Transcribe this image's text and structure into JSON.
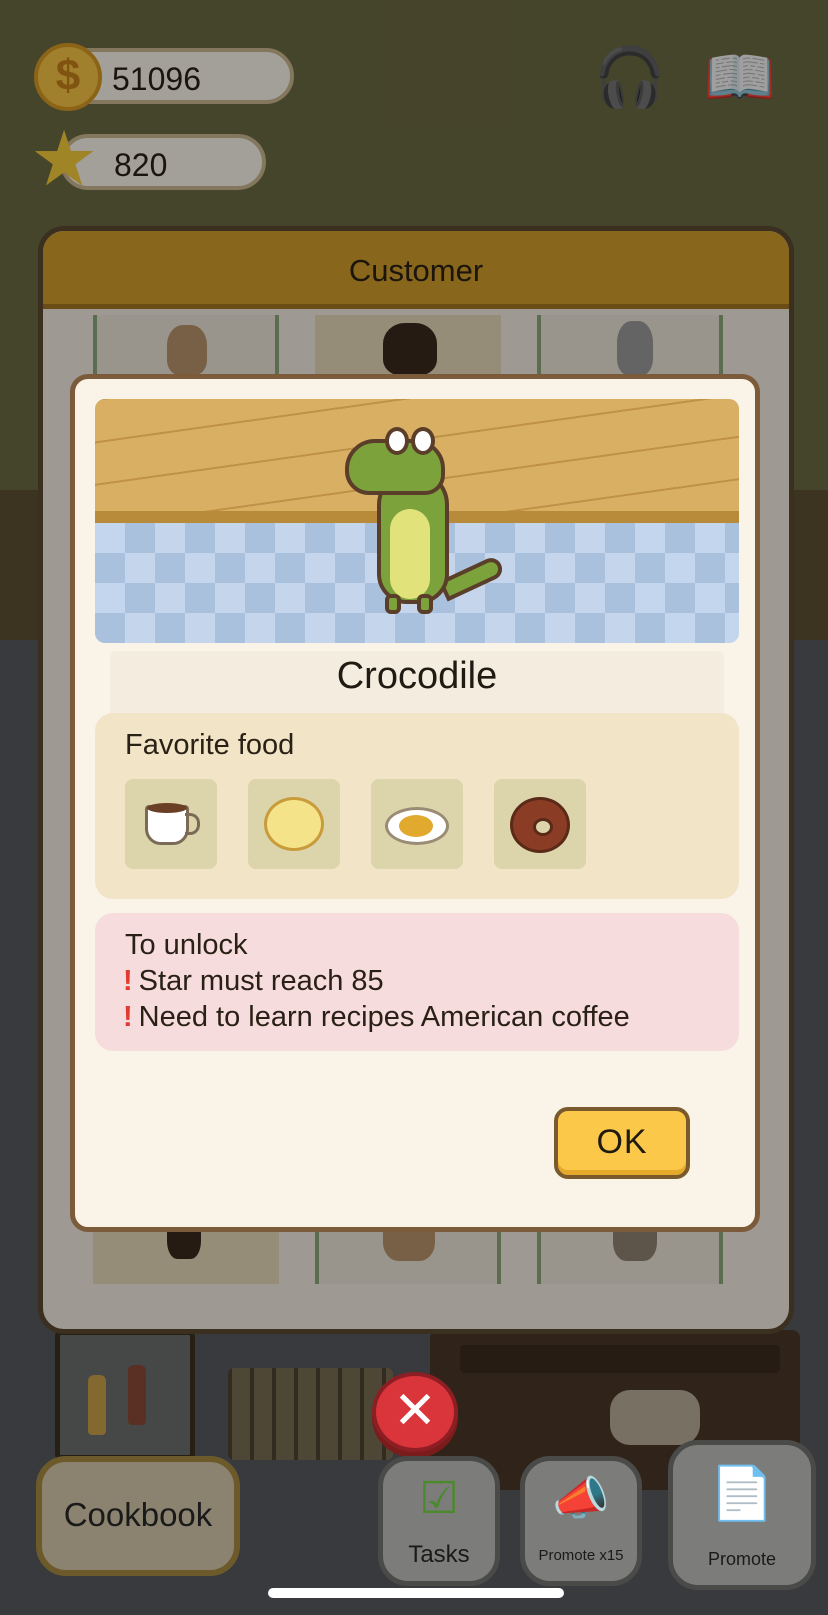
{
  "currency": {
    "coins": "51096",
    "stars": "820"
  },
  "icons": {
    "coin": "dollar-coin-icon",
    "star": "star-icon",
    "headphones": "headphones-icon",
    "journal": "book-icon",
    "close": "close-icon"
  },
  "customer_panel": {
    "title": "Customer"
  },
  "modal": {
    "customer_name": "Crocodile",
    "favorite_food_title": "Favorite food",
    "favorite_foods": [
      {
        "name": "coffee-cup-icon"
      },
      {
        "name": "bun-icon"
      },
      {
        "name": "rice-plate-icon"
      },
      {
        "name": "chocolate-donut-icon"
      }
    ],
    "unlock_title": "To unlock",
    "requirements": [
      "Star must reach 85",
      "Need to learn recipes American coffee"
    ],
    "requirement_mark": "!",
    "ok_label": "OK"
  },
  "close_button": {
    "glyph": "✕"
  },
  "bottom_bar": {
    "cookbook": "Cookbook",
    "tasks": "Tasks",
    "promote_x15": "Promote x15",
    "promote": "Promote"
  },
  "colors": {
    "modal_bg": "#f9f3e8",
    "header": "#d29d2a",
    "ok_button": "#fcc84a",
    "favorite_bg": "#f2e4c6",
    "unlock_bg": "#f7dcdd",
    "requirement_mark": "#e23a30",
    "close_button": "#d9353a"
  }
}
